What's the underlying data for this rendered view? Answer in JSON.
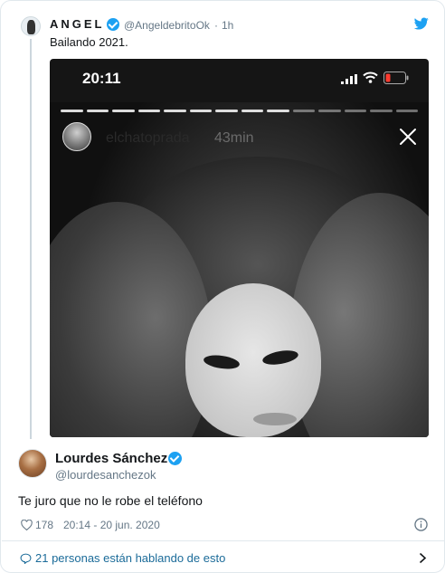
{
  "parent_tweet": {
    "author_name": "ANGEL",
    "handle": "@AngeldebritoOk",
    "separator": "·",
    "time": "1h",
    "text": "Bailando 2021."
  },
  "story": {
    "status_time": "20:11",
    "username": "elchatoprada",
    "age": "43min",
    "progress_segments": 14,
    "progress_filled": 9
  },
  "tweet": {
    "author_name": "Lourdes Sánchez",
    "handle": "@lourdesanchezok",
    "text": "Te juro que no le robe el teléfono",
    "likes": "178",
    "timestamp": "20:14 - 20 jun. 2020"
  },
  "footer": {
    "conversation_text": "21 personas están hablando de esto"
  },
  "colors": {
    "accent": "#1da1f2",
    "muted": "#657786",
    "link": "#1b6b99"
  },
  "icons": [
    "twitter-bird-icon",
    "verified-icon",
    "signal-icon",
    "wifi-icon",
    "battery-icon",
    "close-icon",
    "heart-icon",
    "info-icon",
    "chat-bubble-icon",
    "chevron-right-icon"
  ]
}
